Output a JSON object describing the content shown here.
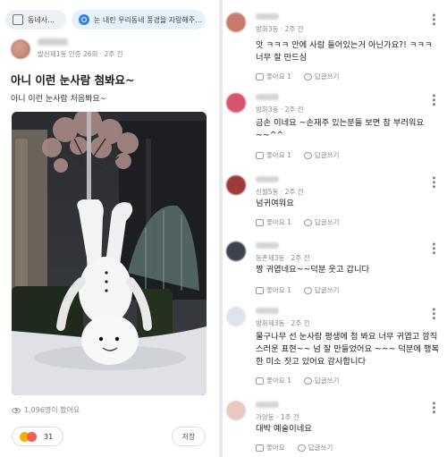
{
  "post": {
    "chips": [
      {
        "label": "동네사…",
        "icon": "board-icon"
      },
      {
        "label": "눈 내린 우리동네 풍경을 자랑해주…",
        "icon": "search-icon"
      }
    ],
    "author_meta": "발신제1동 인증 26회 · 2주 전",
    "title": "아니 이런 눈사람 첨봐요~",
    "body": "아니 이런 눈사람 처음봐요~",
    "views": "1,096명이 봤어요",
    "reaction_count": "31",
    "save_label": "저장"
  },
  "comments": [
    {
      "meta": "방화3동 · 2주 전",
      "text": "앗 ㅋㅋㅋ 안에 사람 들어있는거 아닌가요?! ㅋㅋㅋ 너무 잘 만드심",
      "likes": "좋아요 1",
      "reply": "답글쓰기",
      "avatar_color": "#c97b6b"
    },
    {
      "meta": "방화3동 · 2주 전",
      "text": "금손 이네요 ~손재주 있는분들 보면 참 부러워요~~^^",
      "likes": "좋아요 1",
      "reply": "답글쓰기",
      "avatar_color": "#d9556e"
    },
    {
      "meta": "신월5동 · 2주 전",
      "text": "넘귀여워요",
      "likes": "좋아요 1",
      "reply": "답글쓰기",
      "avatar_color": "#a03a3a"
    },
    {
      "meta": "등촌제3동 · 2주 전",
      "text": "짱 귀엽네요~~덕분 웃고 갑니다",
      "likes": "좋아요 1",
      "reply": "답글쓰기",
      "avatar_color": "#3c4450"
    },
    {
      "meta": "방화제3동 · 2주 전",
      "text": "물구나무 선 눈사람 평생에 첨 봐요 너무 귀엽고 깜직스러운 표현~~ 넘 잘 만들었어요 ~~~ 덕분에 행복한 미소 짓고 있어요 감사합니다",
      "likes": "좋아요 1",
      "reply": "답글쓰기",
      "avatar_color": "#dfe3ea"
    },
    {
      "meta": "가양동 · 1주 전",
      "text": "대박 예술이네요",
      "likes": "좋아요",
      "reply": "답글쓰기",
      "avatar_color": "#e7c9c2"
    }
  ],
  "colors": {
    "accent": "#2f80ed",
    "muted": "#888888"
  }
}
